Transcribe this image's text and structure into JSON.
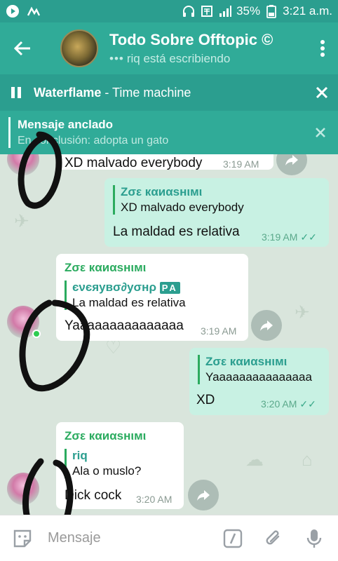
{
  "status_bar": {
    "battery": "35%",
    "time": "3:21 a.m.",
    "icons": [
      "telegram-play-icon",
      "activity-icon",
      "headphones-icon",
      "carrier-icon",
      "signal-icon",
      "battery-icon"
    ]
  },
  "header": {
    "title": "Todo Sobre Offtopic ©",
    "subtitle_dots": "•••",
    "subtitle": "riq está escribiendo",
    "icons": [
      "back-arrow-icon",
      "more-vertical-icon"
    ]
  },
  "player": {
    "artist": "Waterflame",
    "separator": " - ",
    "track": "Time machine"
  },
  "pinned": {
    "title": "Mensaje anclado",
    "body": "En conclusión: adopta un gato"
  },
  "messages": [
    {
      "id": "m1",
      "direction": "in",
      "text": "XD malvado everybody",
      "time": "3:19 AM"
    },
    {
      "id": "m2",
      "direction": "out",
      "sender": "Zσε кαиαѕнιмι",
      "reply_text": "XD malvado everybody",
      "text": "La maldad es relativa",
      "time": "3:19 AM"
    },
    {
      "id": "m3",
      "direction": "in",
      "sender": "Zσε кαиαѕнιмι",
      "reply_name": "єνєяувσ∂уσнρ",
      "reply_badge": "PA",
      "reply_text": "La maldad es relativa",
      "text": "Yaaaaaaaaaaaaaaa",
      "time": "3:19 AM"
    },
    {
      "id": "m4",
      "direction": "out",
      "reply_name": "Zσε кαиαѕнιмι",
      "reply_text": "Yaaaaaaaaaaaaaaa",
      "text": "XD",
      "time": "3:20 AM"
    },
    {
      "id": "m5",
      "direction": "in",
      "sender": "Zσε кαиαѕнιмι",
      "reply_name": "riq",
      "reply_text": "Ala o muslo?",
      "text": "Dick cock",
      "time": "3:20 AM"
    }
  ],
  "input": {
    "placeholder": "Mensaje",
    "icons": [
      "sticker-icon",
      "command-slash-icon",
      "attach-icon",
      "microphone-icon"
    ]
  },
  "colors": {
    "toolbar": "#30ab98",
    "statusbar": "#2b9e8f",
    "outgoing_bubble": "#c8f1e3",
    "incoming_bubble": "#ffffff",
    "sender_green": "#2bab5f"
  }
}
